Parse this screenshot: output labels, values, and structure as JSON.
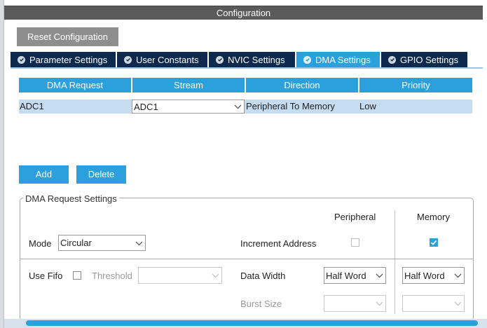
{
  "title": "Configuration",
  "reset_button": "Reset Configuration",
  "tabs": [
    {
      "label": "Parameter Settings",
      "active": false
    },
    {
      "label": "User Constants",
      "active": false
    },
    {
      "label": "NVIC Settings",
      "active": false
    },
    {
      "label": "DMA Settings",
      "active": true
    },
    {
      "label": "GPIO Settings",
      "active": false
    }
  ],
  "table": {
    "headers": [
      "DMA Request",
      "Stream",
      "Direction",
      "Priority"
    ],
    "rows": [
      {
        "request": "ADC1",
        "stream": "ADC1",
        "direction": "Peripheral To Memory",
        "priority": "Low"
      }
    ]
  },
  "actions": {
    "add": "Add",
    "delete": "Delete"
  },
  "settings": {
    "legend": "DMA Request Settings",
    "col_peripheral": "Peripheral",
    "col_memory": "Memory",
    "mode_label": "Mode",
    "mode_value": "Circular",
    "increment_label": "Increment Address",
    "increment_peripheral": false,
    "increment_memory": true,
    "fifo_label": "Use Fifo",
    "fifo_checked": false,
    "threshold_label": "Threshold",
    "threshold_value": "",
    "data_width_label": "Data Width",
    "data_width_peripheral": "Half Word",
    "data_width_memory": "Half Word",
    "burst_label": "Burst Size",
    "burst_peripheral": "",
    "burst_memory": ""
  },
  "colors": {
    "accent": "#2ba0dc",
    "tab_inactive": "#0d2a4e",
    "header_bar": "#5a5a5a",
    "row_selected": "#c6dcf0"
  },
  "icons": {
    "tab_status": "check-circle-icon",
    "dropdown": "chevron-down-icon"
  }
}
